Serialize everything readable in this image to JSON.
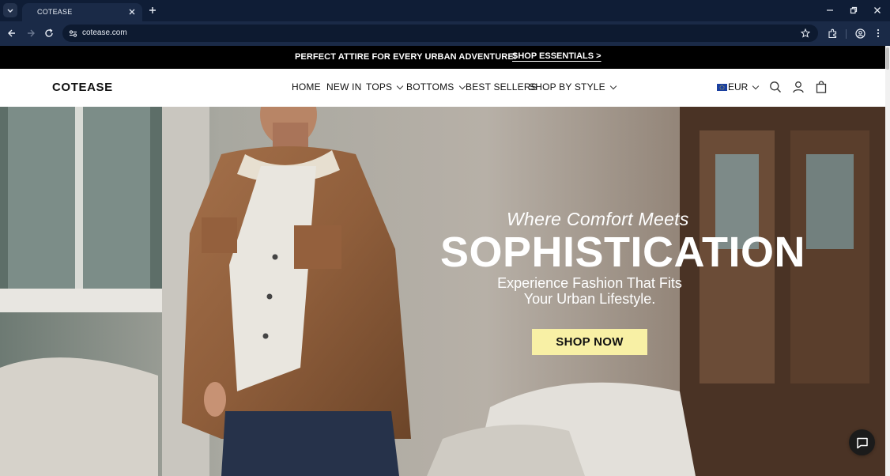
{
  "browser": {
    "tab_title": "COTEASE",
    "url": "cotease.com",
    "icons": [
      "tab-list-icon",
      "close-icon",
      "plus-icon",
      "minimize-icon",
      "restore-icon",
      "window-close-icon",
      "back-icon",
      "forward-icon",
      "reload-icon",
      "site-info-icon",
      "star-icon",
      "extensions-icon",
      "profile-icon",
      "menu-icon"
    ]
  },
  "announcement": {
    "text": "PERFECT ATTIRE FOR EVERY URBAN ADVENTURE!",
    "link": "SHOP ESSENTIALS >"
  },
  "header": {
    "logo": "COTEASE",
    "nav": [
      {
        "label": "HOME",
        "has_dropdown": false
      },
      {
        "label": "NEW IN",
        "has_dropdown": false
      },
      {
        "label": "TOPS",
        "has_dropdown": true
      },
      {
        "label": "BOTTOMS",
        "has_dropdown": true
      },
      {
        "label": "BEST SELLERS",
        "has_dropdown": false
      },
      {
        "label": "SHOP BY STYLE",
        "has_dropdown": true
      }
    ],
    "currency": "EUR",
    "icons": [
      "search-icon",
      "account-icon",
      "cart-icon"
    ]
  },
  "hero": {
    "eyebrow": "Where Comfort Meets",
    "title": "SOPHISTICATION",
    "subtitle": "Experience Fashion That Fits Your Urban Lifestyle.",
    "cta": "SHOP NOW"
  },
  "colors": {
    "announcement_bg": "#000000",
    "cta_bg": "#f8f0a5",
    "browser_frame": "#0f1d36",
    "browser_toolbar": "#1a2a47"
  }
}
